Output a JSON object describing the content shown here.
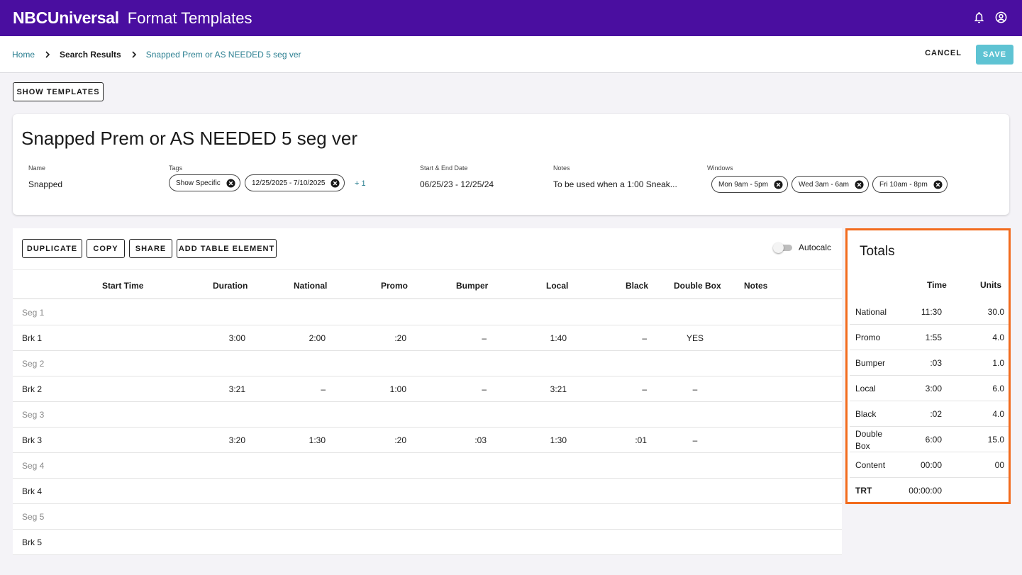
{
  "header": {
    "brand": "NBCUniversal",
    "title": "Format Templates",
    "icons": [
      "bell-icon",
      "account-icon"
    ]
  },
  "breadcrumb": {
    "home": "Home",
    "results": "Search Results",
    "current": "Snapped Prem or AS NEEDED 5 seg ver"
  },
  "actions": {
    "cancel": "CANCEL",
    "save": "SAVE"
  },
  "show_templates": "SHOW TEMPLATES",
  "template": {
    "title": "Snapped Prem or AS NEEDED 5 seg ver",
    "name_label": "Name",
    "name": "Snapped",
    "tags_label": "Tags",
    "tags": [
      "Show Specific",
      "12/25/2025 - 7/10/2025"
    ],
    "tags_more": "+ 1",
    "dates_label": "Start & End Date",
    "dates": "06/25/23 - 12/25/24",
    "notes_label": "Notes",
    "notes": "To be used when a 1:00 Sneak...",
    "windows_label": "Windows",
    "windows": [
      "Mon 9am - 5pm",
      "Wed 3am - 6am",
      "Fri 10am - 8pm"
    ]
  },
  "toolbar": {
    "duplicate": "DUPLICATE",
    "copy": "COPY",
    "share": "SHARE",
    "add_element": "ADD TABLE ELEMENT",
    "autocalc": "Autocalc"
  },
  "table": {
    "columns": [
      "Start Time",
      "Duration",
      "National",
      "Promo",
      "Bumper",
      "Local",
      "Black",
      "Double Box",
      "Notes"
    ],
    "rows": [
      {
        "label": "Seg 1",
        "kind": "seg"
      },
      {
        "label": "Brk 1",
        "kind": "brk",
        "duration": "3:00",
        "national": "2:00",
        "promo": ":20",
        "bumper": "–",
        "local": "1:40",
        "black": "–",
        "double_box": "YES"
      },
      {
        "label": "Seg 2",
        "kind": "seg"
      },
      {
        "label": "Brk 2",
        "kind": "brk",
        "duration": "3:21",
        "national": "–",
        "promo": "1:00",
        "bumper": "–",
        "local": "3:21",
        "black": "–",
        "double_box": "–"
      },
      {
        "label": "Seg 3",
        "kind": "seg"
      },
      {
        "label": "Brk 3",
        "kind": "brk",
        "duration": "3:20",
        "national": "1:30",
        "promo": ":20",
        "bumper": ":03",
        "local": "1:30",
        "black": ":01",
        "double_box": "–"
      },
      {
        "label": "Seg 4",
        "kind": "seg"
      },
      {
        "label": "Brk 4",
        "kind": "brk"
      },
      {
        "label": "Seg 5",
        "kind": "seg"
      },
      {
        "label": "Brk 5",
        "kind": "brk"
      }
    ]
  },
  "totals": {
    "title": "Totals",
    "time_header": "Time",
    "units_header": "Units",
    "rows": [
      {
        "label": "National",
        "time": "11:30",
        "units": "30.0"
      },
      {
        "label": "Promo",
        "time": "1:55",
        "units": "4.0"
      },
      {
        "label": "Bumper",
        "time": ":03",
        "units": "1.0"
      },
      {
        "label": "Local",
        "time": "3:00",
        "units": "6.0"
      },
      {
        "label": "Black",
        "time": ":02",
        "units": "4.0"
      },
      {
        "label": "Double Box",
        "time": "6:00",
        "units": "15.0"
      },
      {
        "label": "Content",
        "time": "00:00",
        "units": "00"
      }
    ],
    "trt_label": "TRT",
    "trt_time": "00:00:00"
  },
  "colors": {
    "header_bg": "#4a0ea0",
    "link": "#2b7f91",
    "save_bg": "#5ec3d3",
    "totals_border": "#f26b1d"
  }
}
